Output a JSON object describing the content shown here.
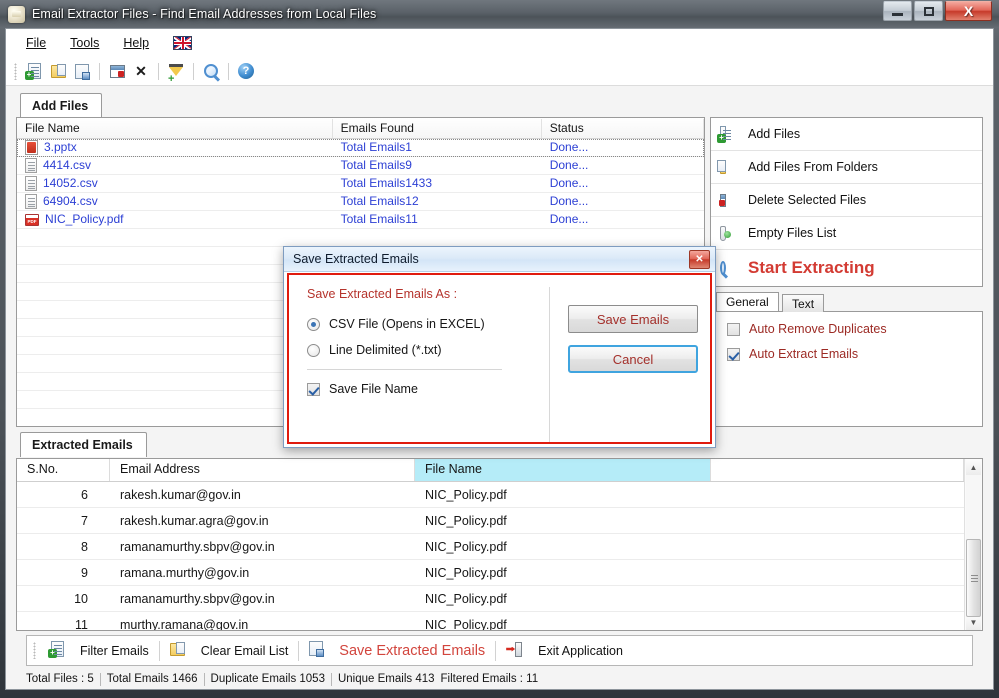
{
  "window": {
    "title": "Email Extractor Files -  Find Email Addresses from Local Files",
    "icon": "app-icon",
    "minimize": "–",
    "maximize": "□",
    "close": "X"
  },
  "menu": {
    "items": [
      {
        "label": "File",
        "accel": "F"
      },
      {
        "label": "Tools",
        "accel": "T"
      },
      {
        "label": "Help",
        "accel": "H"
      }
    ],
    "language_flag": "uk-flag-icon"
  },
  "toolbar": {
    "buttons": [
      {
        "name": "add-file-icon"
      },
      {
        "name": "add-folder-icon"
      },
      {
        "name": "save-file-icon"
      },
      {
        "name": "delete-window-icon"
      },
      {
        "name": "close-x-icon"
      },
      {
        "name": "filter-icon"
      },
      {
        "name": "search-icon"
      },
      {
        "name": "help-icon"
      }
    ]
  },
  "add_files_tab": {
    "label": "Add Files",
    "columns": [
      "File Name",
      "Emails Found",
      "Status"
    ],
    "rows": [
      {
        "file": "3.pptx",
        "icon": "pptx-icon",
        "emails": "Total Emails1",
        "status": "Done..."
      },
      {
        "file": "4414.csv",
        "icon": "csv-icon",
        "emails": "Total Emails9",
        "status": "Done..."
      },
      {
        "file": "14052.csv",
        "icon": "csv-icon",
        "emails": "Total Emails1433",
        "status": "Done..."
      },
      {
        "file": "64904.csv",
        "icon": "csv-icon",
        "emails": "Total Emails12",
        "status": "Done..."
      },
      {
        "file": "NIC_Policy.pdf",
        "icon": "pdf-icon",
        "emails": "Total Emails11",
        "status": "Done..."
      }
    ]
  },
  "actions": {
    "items": [
      {
        "label": "Add Files",
        "icon": "add-file-icon"
      },
      {
        "label": "Add Files From Folders",
        "icon": "folder-icon"
      },
      {
        "label": "Delete Selected Files",
        "icon": "delete-window-icon"
      },
      {
        "label": "Empty Files List",
        "icon": "recycle-bin-icon"
      }
    ],
    "start_label": "Start Extracting",
    "start_icon": "magnifier-icon",
    "start_color": "#d33b33"
  },
  "options": {
    "tabs": [
      {
        "label": "General",
        "active": true
      },
      {
        "label": "Text",
        "active": false
      }
    ],
    "checkboxes": [
      {
        "label": "Auto Remove Duplicates",
        "checked": false
      },
      {
        "label": "Auto Extract Emails",
        "checked": true
      }
    ],
    "label_color": "#9c2a24"
  },
  "extracted_tab": {
    "label": "Extracted Emails",
    "columns": [
      "S.No.",
      "Email Address",
      "File Name"
    ],
    "highlighted_column": "File Name",
    "highlight_color": "#b5ecf8",
    "rows": [
      {
        "sno": "6",
        "email": "rakesh.kumar@gov.in",
        "file": "NIC_Policy.pdf"
      },
      {
        "sno": "7",
        "email": "rakesh.kumar.agra@gov.in",
        "file": "NIC_Policy.pdf"
      },
      {
        "sno": "8",
        "email": "ramanamurthy.sbpv@gov.in",
        "file": "NIC_Policy.pdf"
      },
      {
        "sno": "9",
        "email": "ramana.murthy@gov.in",
        "file": "NIC_Policy.pdf"
      },
      {
        "sno": "10",
        "email": "ramanamurthy.sbpv@gov.in",
        "file": "NIC_Policy.pdf"
      },
      {
        "sno": "11",
        "email": "murthy.ramana@gov.in",
        "file": "NIC_Policy.pdf"
      }
    ],
    "scroll_up": "▲",
    "scroll_down": "▼"
  },
  "bottom_toolbar": {
    "items": [
      {
        "label": "Filter Emails",
        "icon": "filter-file-icon",
        "red": false
      },
      {
        "label": "Clear Email List",
        "icon": "clear-list-icon",
        "red": false
      },
      {
        "label": "Save Extracted Emails",
        "icon": "save-file-icon",
        "red": true
      },
      {
        "label": "Exit Application",
        "icon": "exit-icon",
        "red": false
      }
    ]
  },
  "statusbar": {
    "items": [
      {
        "label": "Total Files : ",
        "value": "5"
      },
      {
        "label": "Total Emails  ",
        "value": "1466"
      },
      {
        "label": "Duplicate Emails  ",
        "value": "1053"
      },
      {
        "label": "Unique Emails  ",
        "value": "413"
      },
      {
        "label": "Filtered Emails : ",
        "value": "11"
      }
    ]
  },
  "dialog": {
    "title": "Save Extracted Emails",
    "close": "✕",
    "heading": "Save Extracted Emails As :",
    "heading_color": "#b5332c",
    "border_color": "#e01b0e",
    "radios": [
      {
        "label": "CSV File (Opens in EXCEL)",
        "checked": true
      },
      {
        "label": "Line Delimited (*.txt)",
        "checked": false
      }
    ],
    "checkbox": {
      "label": "Save File Name",
      "checked": true
    },
    "buttons": [
      {
        "label": "Save Emails",
        "focused": false
      },
      {
        "label": "Cancel",
        "focused": true
      }
    ]
  }
}
